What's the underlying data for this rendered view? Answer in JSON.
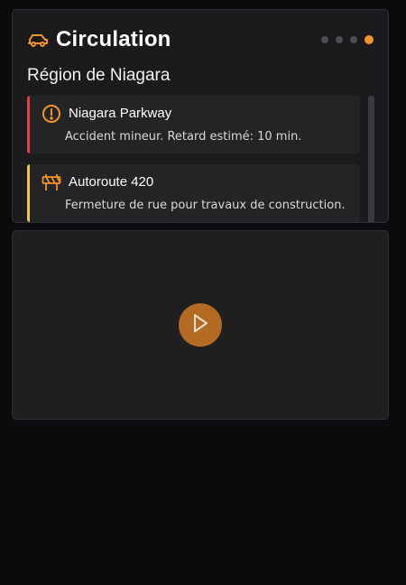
{
  "card": {
    "title": "Circulation",
    "title_icon": "car-icon",
    "region": "Région de Niagara",
    "pagination": {
      "total": 4,
      "active_index": 3
    }
  },
  "incidents": [
    {
      "title": "Niagara Parkway",
      "description": "Accident mineur. Retard estimé: 10 min.",
      "icon": "warning-circle-icon",
      "severity_color": "#e0413d"
    },
    {
      "title": "Autoroute 420",
      "description": "Fermeture de rue pour travaux de construction.",
      "icon": "road-barrier-icon",
      "severity_color": "#f6c344"
    }
  ],
  "video": {
    "play_icon": "play-icon"
  },
  "colors": {
    "accent": "#f5922a",
    "background": "#0a0b0d",
    "card": "#1b1b1d"
  }
}
